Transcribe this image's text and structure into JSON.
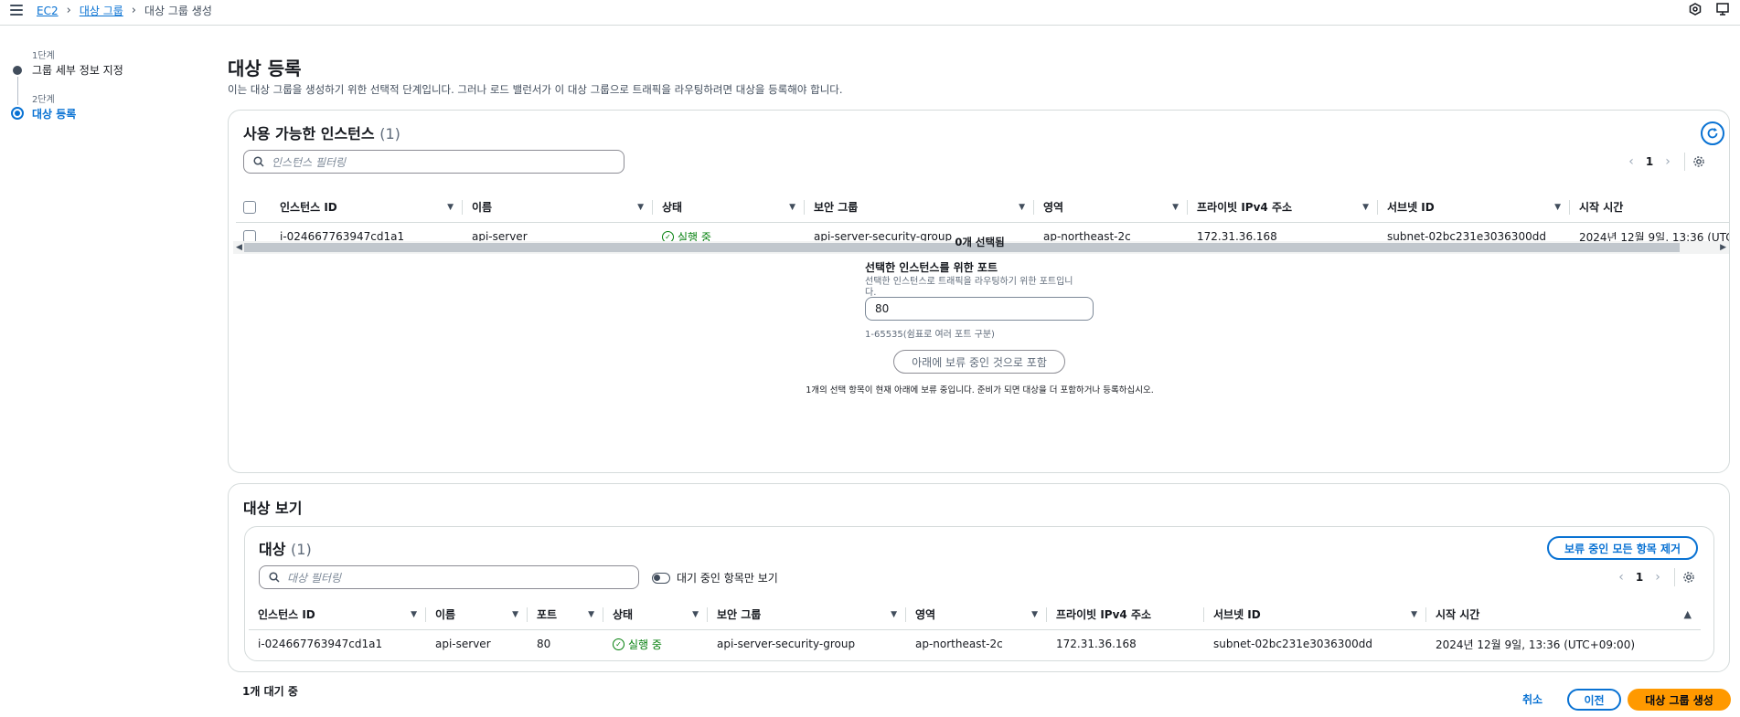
{
  "breadcrumb": {
    "items": [
      "EC2",
      "대상 그룹",
      "대상 그룹 생성"
    ]
  },
  "steps": [
    {
      "small": "1단계",
      "label": "그룹 세부 정보 지정"
    },
    {
      "small": "2단계",
      "label": "대상 등록"
    }
  ],
  "page": {
    "title": "대상 등록",
    "description": "이는 대상 그룹을 생성하기 위한 선택적 단계입니다. 그러나 로드 밸런서가 이 대상 그룹으로 트래픽을 라우팅하려면 대상을 등록해야 합니다."
  },
  "available": {
    "title": "사용 가능한 인스턴스",
    "count": "(1)",
    "filter_placeholder": "인스턴스 필터링",
    "page": "1",
    "columns": [
      "인스턴스 ID",
      "이름",
      "상태",
      "보안 그룹",
      "영역",
      "프라이빗 IPv4 주소",
      "서브넷 ID",
      "시작 시간"
    ],
    "rows": [
      [
        "i-024667763947cd1a1",
        "api-server",
        "실행 중",
        "api-server-security-group",
        "ap-northeast-2c",
        "172.31.36.168",
        "subnet-02bc231e3036300dd",
        "2024년 12월 9일, 13:36 (UTC+"
      ]
    ],
    "selected_count": "0개 선택됨",
    "port_label": "선택한 인스턴스를 위한 포트",
    "port_desc_line1": "선택한 인스턴스로 트래픽을 라우팅하기 위한 포트입니",
    "port_desc_line2": "다.",
    "port_value": "80",
    "port_hint": "1-65535(쉼표로 여러 포트 구분)",
    "include_button": "아래에 보류 중인 것으로 포함",
    "pending_note": "1개의 선택 항목이 현재 아래에 보류 중입니다. 준비가 되면 대상을 더 포함하거나 등록하십시오."
  },
  "review": {
    "title": "대상 보기",
    "targets_title": "대상",
    "targets_count": "(1)",
    "remove_all_button": "보류 중인 모든 항목 제거",
    "filter_placeholder": "대상 필터링",
    "pending_only_label": "대기 중인 항목만 보기",
    "page": "1",
    "columns": [
      "인스턴스 ID",
      "이름",
      "포트",
      "상태",
      "보안 그룹",
      "영역",
      "프라이빗 IPv4 주소",
      "서브넷 ID",
      "시작 시간"
    ],
    "rows": [
      [
        "i-024667763947cd1a1",
        "api-server",
        "80",
        "실행 중",
        "api-server-security-group",
        "ap-northeast-2c",
        "172.31.36.168",
        "subnet-02bc231e3036300dd",
        "2024년 12월 9일, 13:36 (UTC+09:00)"
      ]
    ]
  },
  "footer": {
    "pending_count": "1개 대기 중",
    "cancel": "취소",
    "previous": "이전",
    "create": "대상 그룹 생성"
  },
  "colors": {
    "primary": "#ff9900",
    "link": "#0972d3",
    "success": "#037f0c"
  }
}
